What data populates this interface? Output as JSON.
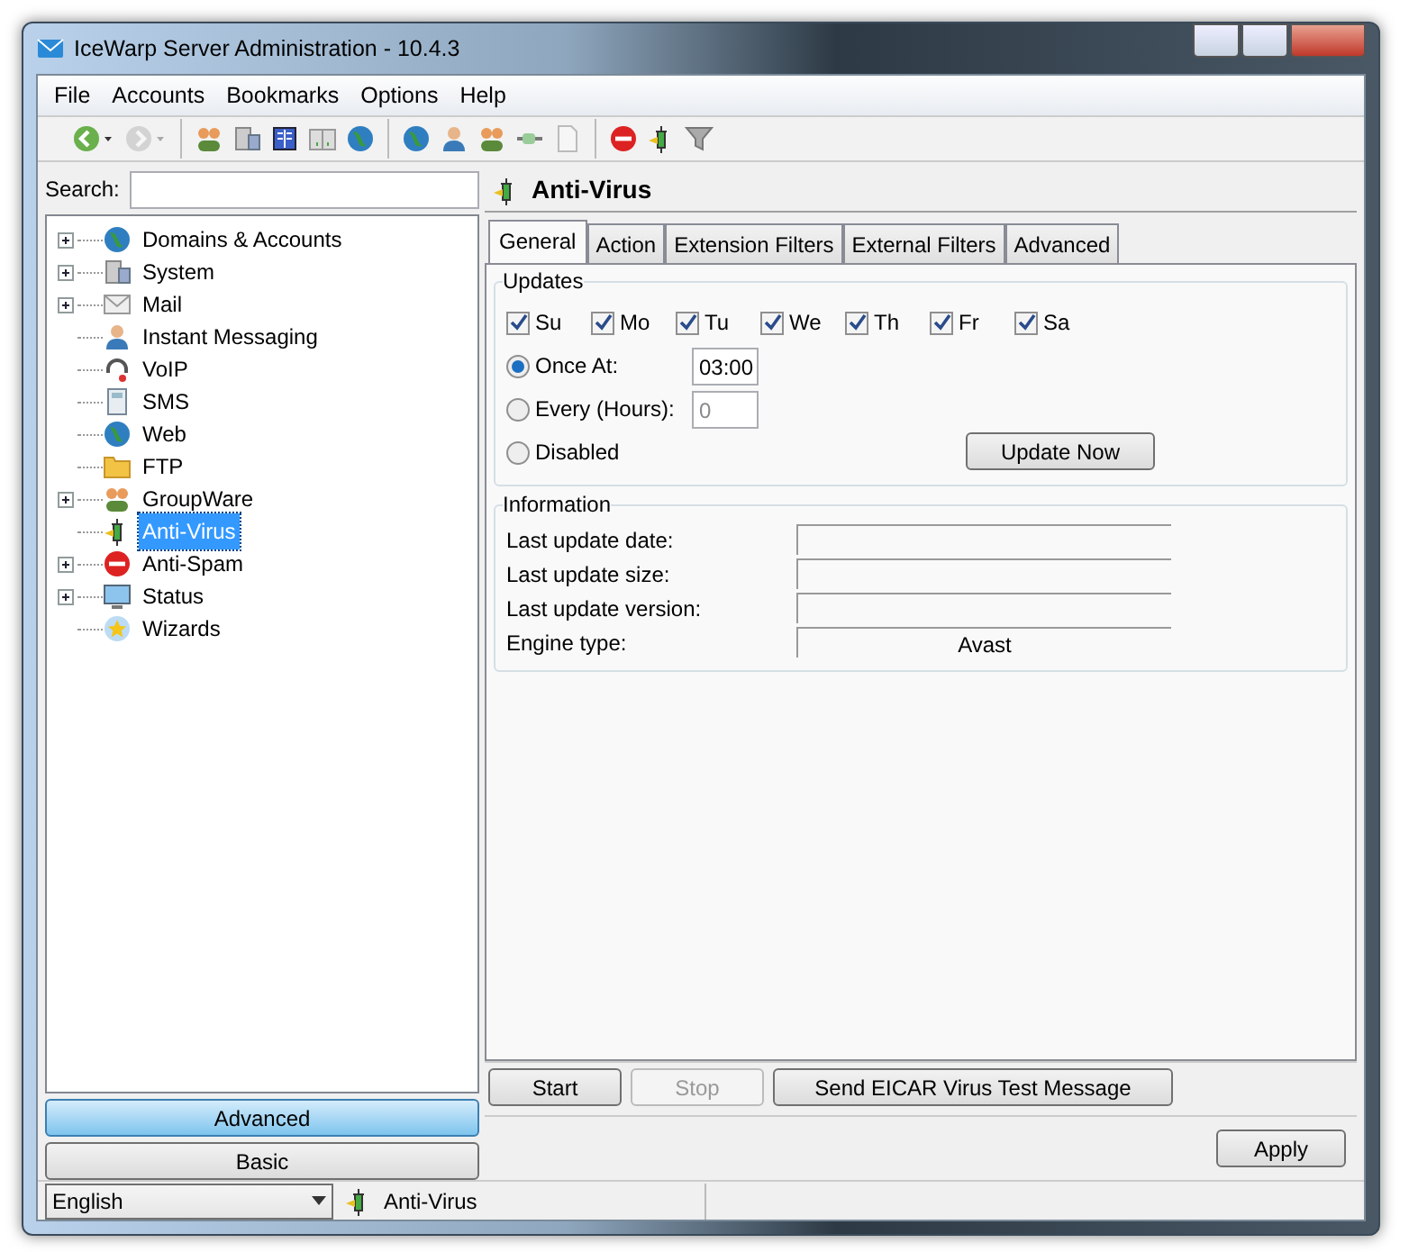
{
  "window": {
    "title": "IceWarp Server Administration - 10.4.3"
  },
  "menu": [
    "File",
    "Accounts",
    "Bookmarks",
    "Options",
    "Help"
  ],
  "toolbar": [
    {
      "disabled": false,
      "dropdown": true
    },
    {
      "disabled": true,
      "dropdown": true
    },
    {
      "disabled": false,
      "dropdown": false
    },
    {
      "disabled": false,
      "dropdown": false
    },
    {
      "disabled": false,
      "dropdown": false
    },
    {
      "disabled": false,
      "dropdown": false
    },
    {
      "disabled": false,
      "dropdown": false
    },
    {
      "disabled": false,
      "dropdown": false
    },
    {
      "disabled": false,
      "dropdown": false
    },
    {
      "disabled": false,
      "dropdown": false
    },
    {
      "disabled": false,
      "dropdown": false
    },
    {
      "disabled": false,
      "dropdown": false
    },
    {
      "disabled": false,
      "dropdown": false
    },
    {
      "disabled": false,
      "dropdown": false
    },
    {
      "disabled": false,
      "dropdown": false
    }
  ],
  "search": {
    "label": "Search:"
  },
  "tree": [
    {
      "label": "Domains & Accounts",
      "expandable": true,
      "selected": false
    },
    {
      "label": "System",
      "expandable": true,
      "selected": false
    },
    {
      "label": "Mail",
      "expandable": true,
      "selected": false
    },
    {
      "label": "Instant Messaging",
      "expandable": false,
      "selected": false
    },
    {
      "label": "VoIP",
      "expandable": false,
      "selected": false
    },
    {
      "label": "SMS",
      "expandable": false,
      "selected": false
    },
    {
      "label": "Web",
      "expandable": false,
      "selected": false
    },
    {
      "label": "FTP",
      "expandable": false,
      "selected": false
    },
    {
      "label": "GroupWare",
      "expandable": true,
      "selected": false
    },
    {
      "label": "Anti-Virus",
      "expandable": false,
      "selected": true
    },
    {
      "label": "Anti-Spam",
      "expandable": true,
      "selected": false
    },
    {
      "label": "Status",
      "expandable": true,
      "selected": false
    },
    {
      "label": "Wizards",
      "expandable": false,
      "selected": false
    }
  ],
  "mode_buttons": [
    {
      "label": "Advanced",
      "selected": true
    },
    {
      "label": "Basic",
      "selected": false
    }
  ],
  "panel": {
    "title": "Anti-Virus",
    "tabs": [
      {
        "label": "General",
        "selected": true
      },
      {
        "label": "Action",
        "selected": false
      },
      {
        "label": "Extension Filters",
        "selected": false
      },
      {
        "label": "External Filters",
        "selected": false
      },
      {
        "label": "Advanced",
        "selected": false
      }
    ],
    "updates": {
      "title": "Updates",
      "days": [
        {
          "label": "Su",
          "checked": true
        },
        {
          "label": "Mo",
          "checked": true
        },
        {
          "label": "Tu",
          "checked": true
        },
        {
          "label": "We",
          "checked": true
        },
        {
          "label": "Th",
          "checked": true
        },
        {
          "label": "Fr",
          "checked": true
        },
        {
          "label": "Sa",
          "checked": true
        }
      ],
      "schedule": [
        {
          "label": "Once At:",
          "selected": true,
          "value": "03:00",
          "disabled": false
        },
        {
          "label": "Every (Hours):",
          "selected": false,
          "value": "0",
          "disabled": true
        },
        {
          "label": "Disabled",
          "selected": false
        }
      ],
      "update_button": "Update Now"
    },
    "information": {
      "title": "Information",
      "fields": [
        {
          "label": "Last update date:"
        },
        {
          "label": "Last update size:"
        },
        {
          "label": "Last update version:"
        },
        {
          "label": "Engine type:",
          "value": "Avast"
        }
      ]
    },
    "buttons": [
      {
        "label": "Start",
        "disabled": false
      },
      {
        "label": "Stop",
        "disabled": true
      },
      {
        "label": "Send EICAR Virus Test Message",
        "disabled": false
      }
    ],
    "apply": "Apply"
  },
  "status_bar": {
    "language": "English",
    "section": "Anti-Virus"
  }
}
